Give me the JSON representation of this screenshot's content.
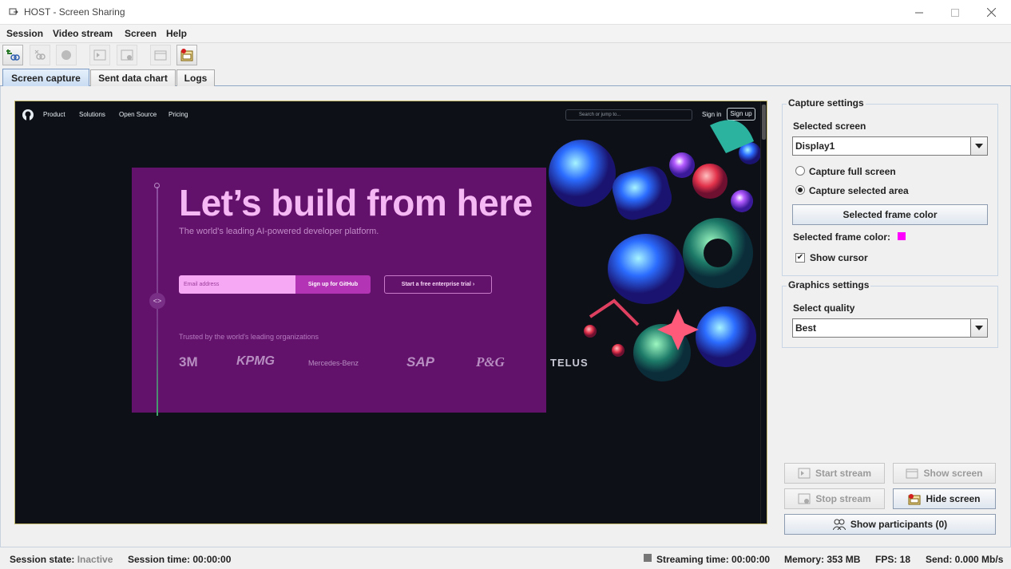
{
  "window": {
    "title": "HOST - Screen Sharing"
  },
  "menu": {
    "items": [
      "Session",
      "Video stream",
      "Screen",
      "Help"
    ]
  },
  "tabs": [
    "Screen capture",
    "Sent data chart",
    "Logs"
  ],
  "preview": {
    "nav": {
      "links": [
        "Product",
        "Solutions",
        "Open Source",
        "Pricing"
      ],
      "search": "Search or jump to...",
      "sign_in": "Sign in",
      "sign_up": "Sign up"
    },
    "hero": {
      "title": "Let’s build from here",
      "subtitle": "The world's leading AI-powered developer platform.",
      "email_placeholder": "Email address",
      "signup_button": "Sign up for GitHub",
      "trial_button": "Start a free enterprise trial ›",
      "trusted": "Trusted by the world's leading organizations",
      "logos": [
        "3M",
        "KPMG",
        "Mercedes-Benz",
        "SAP",
        "P&G",
        "TELUS"
      ]
    }
  },
  "capture_settings": {
    "title": "Capture settings",
    "selected_screen_label": "Selected screen",
    "selected_screen_value": "Display1",
    "option_full": "Capture full screen",
    "option_area": "Capture selected area",
    "selected_option": "area",
    "frame_color_button": "Selected frame color",
    "frame_color_label": "Selected frame color:",
    "frame_color": "#ff00ff",
    "show_cursor_label": "Show cursor",
    "show_cursor": true
  },
  "graphics_settings": {
    "title": "Graphics settings",
    "quality_label": "Select quality",
    "quality_value": "Best"
  },
  "actions": {
    "start_stream": "Start stream",
    "show_screen": "Show screen",
    "stop_stream": "Stop stream",
    "hide_screen": "Hide screen",
    "show_participants": "Show participants (0)"
  },
  "status": {
    "session_state_label": "Session state:",
    "session_state_value": "Inactive",
    "session_time": "Session time: 00:00:00",
    "streaming_time": "Streaming time: 00:00:00",
    "memory": "Memory: 353 MB",
    "fps": "FPS: 18",
    "send": "Send: 0.000 Mb/s"
  }
}
